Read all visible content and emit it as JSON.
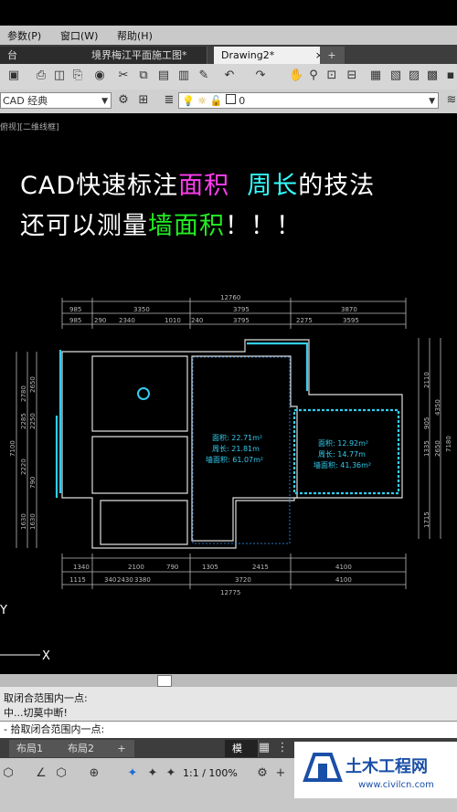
{
  "menu": {
    "params": "参数(P)",
    "window": "窗口(W)",
    "help": "帮助(H)"
  },
  "tabs": [
    {
      "label": "台"
    },
    {
      "label": "境界梅江平面施工图*"
    },
    {
      "label": "Drawing2*"
    }
  ],
  "tab_close": "×",
  "new_tab": "+",
  "workspace": "CAD 经典",
  "layer": "0",
  "viewport_label": "俯视][二维线框]",
  "title": {
    "line1_a": "CAD快速标注",
    "line1_b": "面积",
    "line1_c": "周长",
    "line1_d": "的技法",
    "line2_a": "还可以测量",
    "line2_b": "墙面积",
    "line2_c": "！！！"
  },
  "colors": {
    "magenta": "#ff3df0",
    "cyan": "#33ffff",
    "green": "#22ee22",
    "room": "#33ccee",
    "dim": "#bbbbbb"
  },
  "dims": {
    "total_top": "12760",
    "top_row1": [
      "985",
      "3350",
      "3795",
      "3870"
    ],
    "top_row2": [
      "985",
      "290",
      "2340",
      "1010",
      "240",
      "3795",
      "2275",
      "3595"
    ],
    "bottom_row1": [
      "1340",
      "2100",
      "790",
      "1305",
      "2415",
      "4100"
    ],
    "bottom_row2": [
      "1115",
      "340",
      "2430",
      "3380",
      "3720",
      "4100"
    ],
    "total_bottom": "12775",
    "left_outer": "7100",
    "left_a": [
      "2780",
      "2285",
      "2220",
      "1630"
    ],
    "left_b": [
      "2650",
      "2250",
      "790",
      "1630"
    ],
    "right_a": [
      "2110",
      "905",
      "1335",
      "1715"
    ],
    "right_b": [
      "4350",
      "2650"
    ],
    "right_outer": "7180"
  },
  "room_big": {
    "area": "面积:   22.71m²",
    "perimeter": "周长:   21.81m",
    "wall": "墙面积:  61.07m²"
  },
  "room_right": {
    "area": "面积:   12.92m²",
    "perimeter": "周长:   14.77m",
    "wall": "墙面积:  41.36m²"
  },
  "axis": {
    "y": "Y",
    "x": "X"
  },
  "command": {
    "line1": "取闭合范围内一点:",
    "line2": "中...切莫中断!",
    "prompt": "- 拾取闭合范围内一点:"
  },
  "layouts": [
    "布局1",
    "布局2"
  ],
  "model_label": "模型",
  "zoom": "1:1 / 100%",
  "watermark": {
    "name": "土木工程网",
    "url": "www.civilcn.com"
  }
}
